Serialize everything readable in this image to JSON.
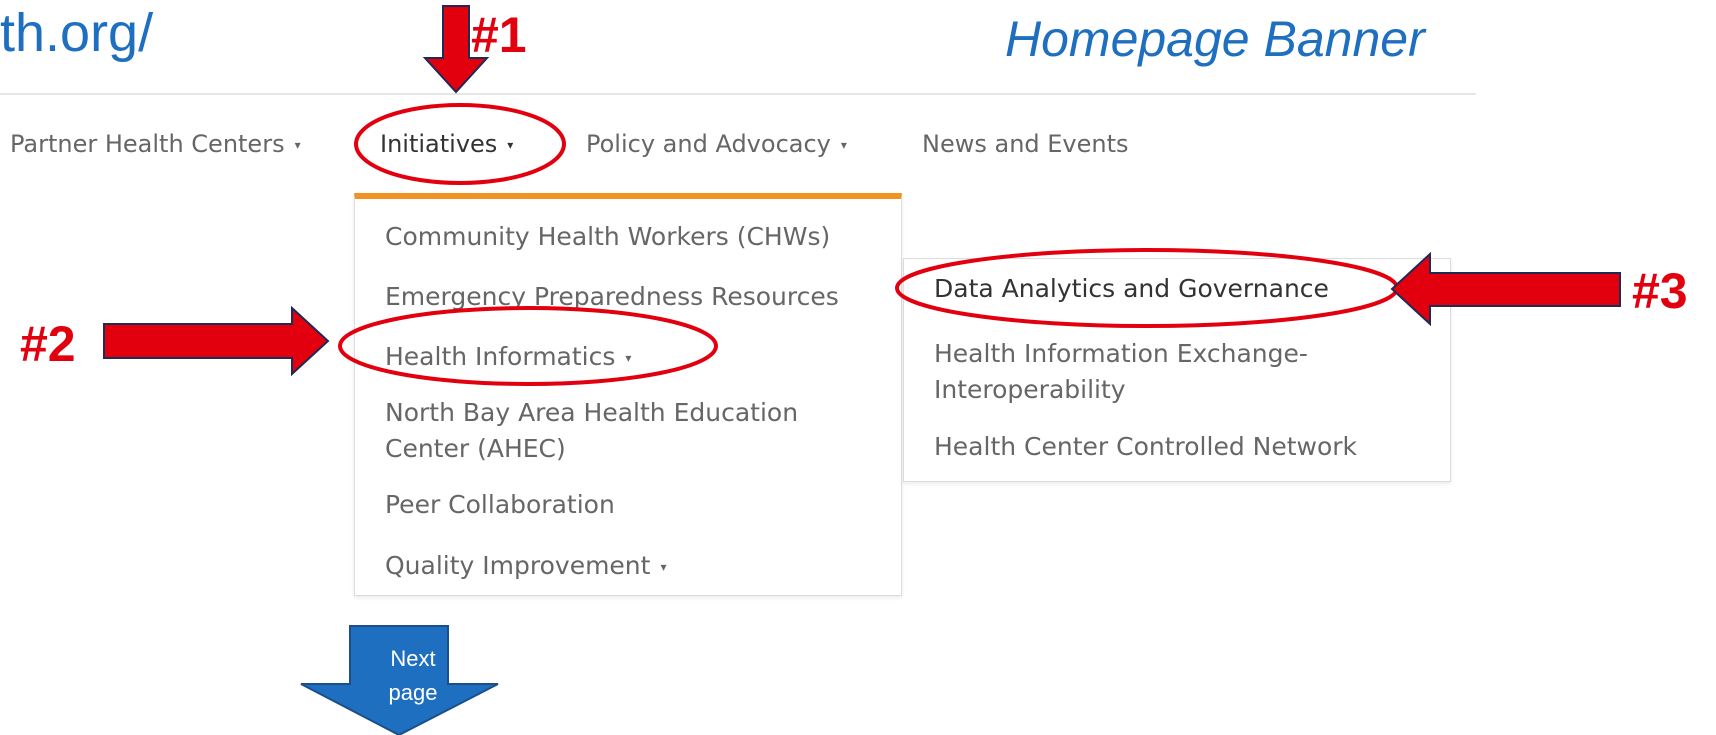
{
  "header": {
    "url_fragment": "th.org/",
    "banner_title": "Homepage Banner"
  },
  "nav": {
    "items": [
      {
        "label": "Partner Health Centers",
        "caret": "▾"
      },
      {
        "label": "Initiatives",
        "caret": "▾"
      },
      {
        "label": "Policy and Advocacy",
        "caret": "▾"
      },
      {
        "label": "News and Events"
      }
    ]
  },
  "initiatives_menu": {
    "items": [
      {
        "label": "Community Health Workers (CHWs)"
      },
      {
        "label": "Emergency Preparedness Resources"
      },
      {
        "label": "Health Informatics",
        "caret": "▾"
      },
      {
        "label_line1": "North Bay Area Health Education",
        "label_line2": "Center (AHEC)"
      },
      {
        "label": "Peer Collaboration"
      },
      {
        "label": "Quality Improvement",
        "caret": "▾"
      }
    ]
  },
  "health_informatics_submenu": {
    "items": [
      {
        "label": "Data Analytics and Governance"
      },
      {
        "label_line1": "Health Information Exchange-",
        "label_line2": "Interoperability"
      },
      {
        "label": "Health Center Controlled Network"
      }
    ]
  },
  "annotations": {
    "step1": "#1",
    "step2": "#2",
    "step3": "#3",
    "next_line1": "Next",
    "next_line2": "page"
  },
  "colors": {
    "annotation_red": "#e2000f",
    "link_blue": "#1F6FC0",
    "menu_accent_orange": "#f29222",
    "next_arrow_blue": "#1F6FC0"
  }
}
